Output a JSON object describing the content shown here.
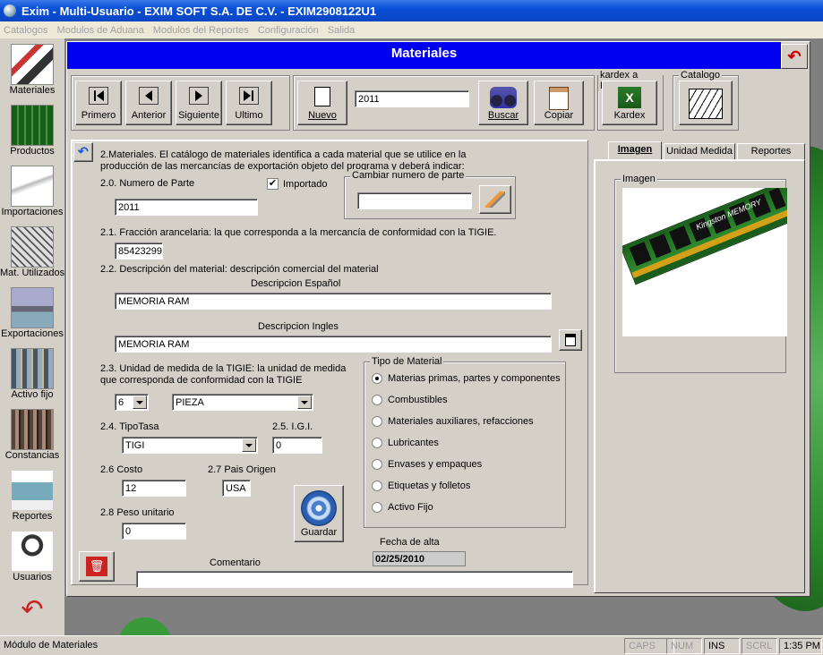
{
  "window_title": "Exim - Multi-Usuario - EXIM SOFT S.A. DE C.V. - EXIM2908122U1",
  "menu": [
    "Catalogos",
    "Modulos de Aduana",
    "Modulos del Reportes",
    "Configuración",
    "Salida"
  ],
  "sidebar": {
    "items": [
      {
        "label": "Materiales",
        "icon": "materials-icon"
      },
      {
        "label": "Productos",
        "icon": "chip-icon"
      },
      {
        "label": "Importaciones",
        "icon": "airplane-icon"
      },
      {
        "label": "Mat. Utilizados",
        "icon": "parts-icon"
      },
      {
        "label": "Exportaciones",
        "icon": "ship-icon"
      },
      {
        "label": "Activo fijo",
        "icon": "warehouse-icon"
      },
      {
        "label": "Constancias",
        "icon": "people-icon"
      },
      {
        "label": "Reportes",
        "icon": "printer-icon"
      },
      {
        "label": "Usuarios",
        "icon": "padlock-icon"
      }
    ],
    "back_icon": "back-arrow-icon"
  },
  "form": {
    "title": "Materiales",
    "toolbar": {
      "first": "Primero",
      "previous": "Anterior",
      "next": "Siguiente",
      "last": "Ultimo",
      "new": "Nuevo",
      "record_value": "2011",
      "search": "Buscar",
      "copy": "Copiar",
      "kardex_group": "kardex a Excel",
      "kardex": "Kardex",
      "catalog_group": "Catalogo"
    },
    "intro": "2.Materiales. El catálogo de materiales identifica a cada material que se utilice en la producción de las mercancías de exportación objeto del programa y deberá indicar:",
    "part_number_label": "2.0. Numero de Parte",
    "part_number": "2011",
    "imported_label": "Importado",
    "imported_checked": true,
    "change_part_group": "Cambiar numero de parte",
    "change_part_value": "",
    "tariff_label": "2.1. Fracción arancelaria: la que corresponda a la mercancía de conformidad con la TIGIE.",
    "tariff": "85423299",
    "description_label": "2.2. Descripción del material: descripción comercial del material",
    "desc_es_label": "Descripcion Español",
    "desc_es": "MEMORIA RAM",
    "desc_en_label": "Descripcion Ingles",
    "desc_en": "MEMORIA RAM",
    "unit_label": "2.3. Unidad de medida de la TIGIE: la unidad de medida que corresponda de conformidad con la TIGIE",
    "unit_code": "6",
    "unit_name": "PIEZA",
    "rate_type_label": "2.4. TipoTasa",
    "rate_type": "TIGI",
    "igi_label": "2.5. I.G.I.",
    "igi": "0",
    "cost_label": "2.6 Costo",
    "cost": "12",
    "origin_label": "2.7 Pais Origen",
    "origin": "USA",
    "weight_label": "2.8 Peso unitario",
    "weight": "0",
    "save": "Guardar",
    "registration_label": "Fecha de alta",
    "registration_date": "02/25/2010",
    "comment_label": "Comentario",
    "comment": "",
    "material_type_group": "Tipo de Material",
    "material_types": [
      {
        "label": "Materias primas, partes y componentes",
        "selected": true
      },
      {
        "label": "Combustibles",
        "selected": false
      },
      {
        "label": "Materiales auxiliares, refacciones",
        "selected": false
      },
      {
        "label": "Lubricantes",
        "selected": false
      },
      {
        "label": "Envases y empaques",
        "selected": false
      },
      {
        "label": "Etiquetas y folletos",
        "selected": false
      },
      {
        "label": "Activo Fijo",
        "selected": false
      }
    ],
    "tabs": [
      {
        "label": "Imagen",
        "active": true
      },
      {
        "label": "Unidad Medida",
        "active": false
      },
      {
        "label": "Reportes",
        "active": false
      }
    ],
    "image_group": "Imagen",
    "image_brand_text": "Kingston MEMORY"
  },
  "status": {
    "module": "Módulo de Materiales",
    "caps": "CAPS",
    "num": "NUM",
    "ins": "INS",
    "scrl": "SCRL",
    "time": "1:35 PM"
  },
  "colors": {
    "title_bar": "#0a46c4",
    "form_title": "#0000f0",
    "face": "#d4d0c8",
    "danger": "#cc2222"
  }
}
